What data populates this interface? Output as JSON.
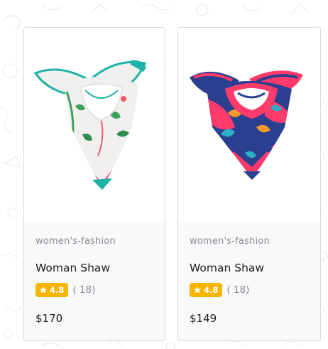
{
  "products": [
    {
      "category": "women's-fashion",
      "title": "Woman Shaw",
      "rating": "4.8",
      "review_count": "( 18)",
      "price": "$170",
      "image_icon": "scarf-icon",
      "palette": {
        "base": "#f1f0ee",
        "primary": "#1eb3a6",
        "accent": "#ef5a6f",
        "leaf": "#3aa15c"
      }
    },
    {
      "category": "women's-fashion",
      "title": "Woman Shaw",
      "rating": "4.8",
      "review_count": "( 18)",
      "price": "$149",
      "image_icon": "scarf-icon",
      "palette": {
        "base": "#2a3f8f",
        "primary": "#ff3b6b",
        "accent": "#f59a2a",
        "leaf": "#2ab0c8"
      }
    }
  ],
  "rating_icon": "star-icon",
  "colors": {
    "rating_badge": "#f7b500",
    "card_border": "#d9d9dc",
    "card_background": "#f8f9fb",
    "text_muted": "#8a8a8f",
    "text_primary": "#1d1d1f"
  }
}
